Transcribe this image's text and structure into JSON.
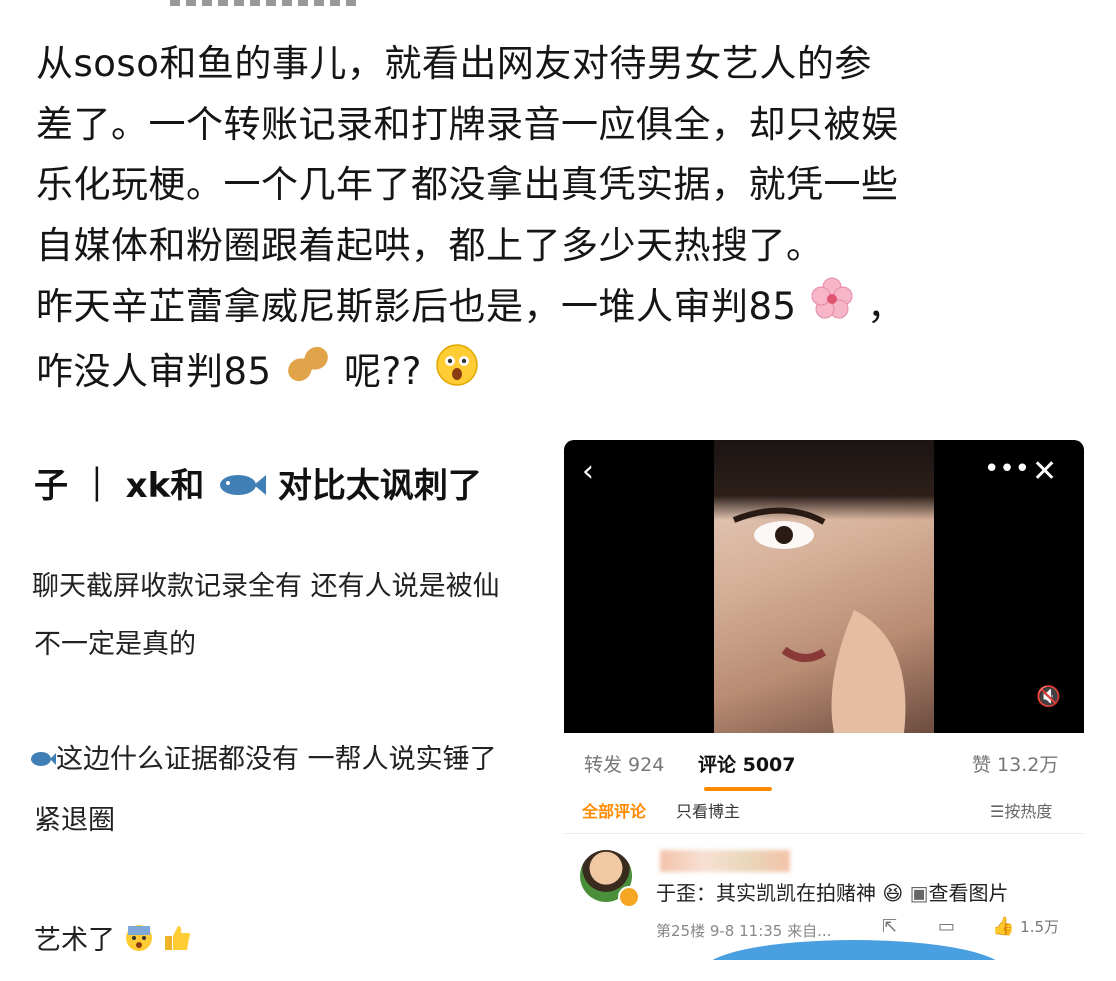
{
  "post": {
    "lines": [
      "从soso和鱼的事儿，就看出网友对待男女艺人的参",
      "差了。一个转账记录和打牌录音一应俱全，却只被娱",
      "乐化玩梗。一个几年了都没拿出真凭实据，就凭一些",
      "自媒体和粉圈跟着起哄，都上了多少天热搜了。",
      "昨天辛芷蕾拿威尼斯影后也是，一堆人审判85",
      "，",
      "咋没人审判85",
      "呢??"
    ],
    "emoji": [
      "flower-emoji",
      "peanut-emoji",
      "shocked-face-emoji"
    ]
  },
  "left_screenshot": {
    "title": "子 ｜ xk和",
    "title_suffix": "对比太讽刺了",
    "lines": [
      "​聊天截屏收款记录全有 还有人说是被仙",
      "不一定是真的",
      "这边什么证据都没有 一帮人说实锤了",
      "紧退圈",
      "艺术了"
    ]
  },
  "right_screenshot": {
    "icons": [
      "back-icon",
      "more-icon",
      "close-icon",
      "mute-icon"
    ],
    "stats": {
      "repost": "转发 924",
      "comment": "评论 5007",
      "like": "赞 13.2万"
    },
    "sub_tabs": {
      "all": "全部评论",
      "author": "只看博主",
      "sort": "按热度"
    },
    "comment": {
      "text": "于歪：其实凯凯在拍赌神",
      "link": "查看图片",
      "meta": "第25楼 9-8 11:35 来自...",
      "likes": "1.5万"
    },
    "accent": "#ff8a00"
  }
}
